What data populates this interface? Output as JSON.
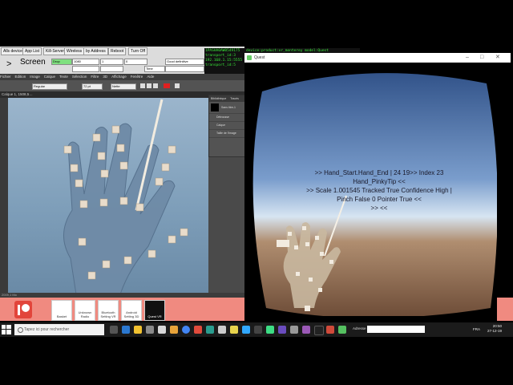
{
  "toolbar": {
    "buttons": [
      "Alls devices",
      "App List",
      "Kill-Server",
      "Wireless",
      "by Address",
      "Reboot",
      "Turn Off"
    ],
    "screen_label": "Screen",
    "drop_label": "Drop",
    "fields": [
      "1080",
      "1",
      "0",
      "Good definitive"
    ],
    "time_label": "Time"
  },
  "console": {
    "lines": [
      "1PASHA0AW0549175",
      "transport_id:3",
      "192.168.1.15:5555",
      "transport_id:5"
    ],
    "header": "device:product:vr_monterey model:Quest device:monterey"
  },
  "photoshop": {
    "menu": [
      "Fichier",
      "Edition",
      "Image",
      "Calque",
      "Texte",
      "Sélection",
      "Filtre",
      "3D",
      "Affichage",
      "Fenêtre",
      "Aide"
    ],
    "font_field": "Regular",
    "size_field": "72 pt",
    "aa_field": "Nette",
    "doc_tab": "Calque 1, 1508,5…",
    "status": "2009,1 Mo",
    "layers_title": "Bibliothèque",
    "layers_tabs": [
      "Bibliothèque",
      "Tracés"
    ],
    "layers": [
      "Sans titre-1",
      "Détrousse",
      "Calque",
      "Taille de l'image"
    ]
  },
  "quest": {
    "title": "Quest",
    "lines": [
      ">>  Hand_Start.Hand_End  |  24 19>>  Index 23",
      "Hand_PinkyTip <<",
      ">>  Scale 1.001545 Tracked True Confidence High |",
      "Pinch False 0 Pointer True <<",
      ">>  <<"
    ]
  },
  "tiles": [
    "Basket",
    "Unknown Radio",
    "Bluetooth Setting VR",
    "Android Setting 3D",
    "Quest VR"
  ],
  "taskbar": {
    "search_placeholder": "Tapez ici pour rechercher",
    "address_label": "Adresse",
    "lang": "FRA",
    "time": "20:50",
    "date": "27-12-19"
  },
  "colors": {
    "toolbar_bg": "#dcdcdc",
    "console_green": "#39e639",
    "tile_strip": "#f08a80",
    "taskbar": "#1b1b1b"
  }
}
